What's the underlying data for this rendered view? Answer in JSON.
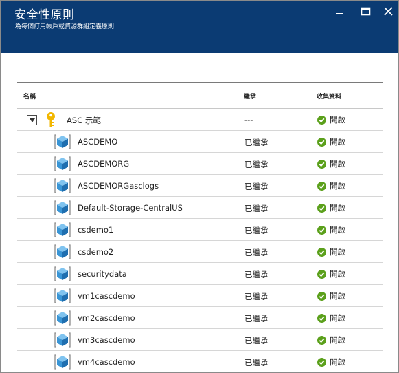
{
  "header": {
    "title": "安全性原則",
    "subtitle": "為每個訂用帳戶或資源群組定義原則"
  },
  "columns": {
    "name": "名稱",
    "inherit": "繼承",
    "collect": "收集資料"
  },
  "group": {
    "name": "ASC 示範",
    "inherit": "---",
    "collect": "開啟",
    "expanded": true
  },
  "rows": [
    {
      "name": "ASCDEMO",
      "inherit": "已繼承",
      "collect": "開啟"
    },
    {
      "name": "ASCDEMORG",
      "inherit": "已繼承",
      "collect": "開啟"
    },
    {
      "name": "ASCDEMORGasclogs",
      "inherit": "已繼承",
      "collect": "開啟"
    },
    {
      "name": "Default-Storage-CentralUS",
      "inherit": "已繼承",
      "collect": "開啟"
    },
    {
      "name": "csdemo1",
      "inherit": "已繼承",
      "collect": "開啟"
    },
    {
      "name": "csdemo2",
      "inherit": "已繼承",
      "collect": "開啟"
    },
    {
      "name": "securitydata",
      "inherit": "已繼承",
      "collect": "開啟"
    },
    {
      "name": "vm1cascdemo",
      "inherit": "已繼承",
      "collect": "開啟"
    },
    {
      "name": "vm2cascdemo",
      "inherit": "已繼承",
      "collect": "開啟"
    },
    {
      "name": "vm3cascdemo",
      "inherit": "已繼承",
      "collect": "開啟"
    },
    {
      "name": "vm4cascdemo",
      "inherit": "已繼承",
      "collect": "開啟"
    }
  ],
  "icons": {
    "minimize": "minimize-icon",
    "maximize": "maximize-icon",
    "close": "close-icon",
    "key": "key-icon",
    "resource_group": "resource-group-icon",
    "status": "check-circle-icon"
  },
  "colors": {
    "header_bg": "#0b3b73",
    "status_green": "#5ba01b",
    "resource_blue": "#3a96d6",
    "key_gold": "#f2b701"
  }
}
